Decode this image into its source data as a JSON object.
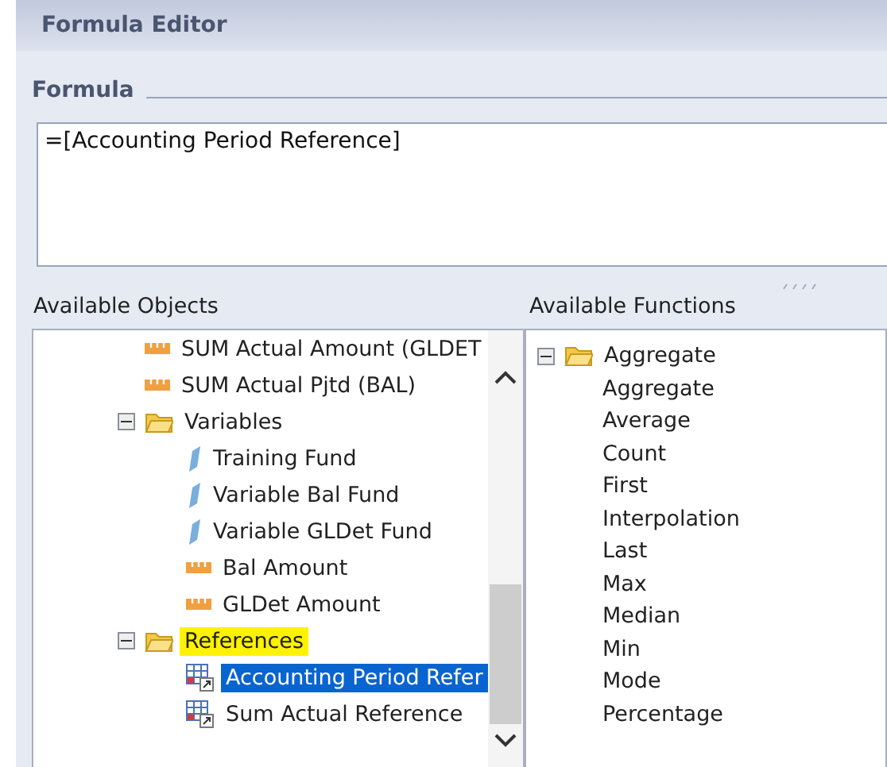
{
  "window": {
    "title": "Formula Editor"
  },
  "formula": {
    "label": "Formula",
    "value": "=[Accounting Period Reference]"
  },
  "objects": {
    "label": "Available Objects",
    "items": [
      {
        "kind": "measure",
        "label": "SUM Actual Amount (GLDET",
        "selected": false
      },
      {
        "kind": "measure",
        "label": "SUM Actual Pjtd (BAL)",
        "selected": false
      },
      {
        "kind": "folder",
        "label": "Variables",
        "expanded": true,
        "highlighted": false,
        "selected": false,
        "children": [
          {
            "kind": "variable",
            "label": "Training Fund",
            "selected": false
          },
          {
            "kind": "variable",
            "label": "Variable Bal Fund",
            "selected": false
          },
          {
            "kind": "variable",
            "label": "Variable GLDet Fund",
            "selected": false
          },
          {
            "kind": "measure",
            "label": "Bal Amount",
            "selected": false
          },
          {
            "kind": "measure",
            "label": "GLDet Amount",
            "selected": false
          }
        ]
      },
      {
        "kind": "folder",
        "label": "References",
        "expanded": true,
        "highlighted": true,
        "selected": false,
        "children": [
          {
            "kind": "reference",
            "label": "Accounting Period Refer",
            "selected": true
          },
          {
            "kind": "reference",
            "label": "Sum Actual Reference",
            "selected": false
          }
        ]
      }
    ]
  },
  "functions": {
    "label": "Available Functions",
    "items": [
      {
        "kind": "folder",
        "label": "Aggregate",
        "expanded": true,
        "children": [
          {
            "kind": "function",
            "label": "Aggregate"
          },
          {
            "kind": "function",
            "label": "Average"
          },
          {
            "kind": "function",
            "label": "Count"
          },
          {
            "kind": "function",
            "label": "First"
          },
          {
            "kind": "function",
            "label": "Interpolation"
          },
          {
            "kind": "function",
            "label": "Last"
          },
          {
            "kind": "function",
            "label": "Max"
          },
          {
            "kind": "function",
            "label": "Median"
          },
          {
            "kind": "function",
            "label": "Min"
          },
          {
            "kind": "function",
            "label": "Mode"
          },
          {
            "kind": "function",
            "label": "Percentage"
          }
        ]
      }
    ]
  }
}
